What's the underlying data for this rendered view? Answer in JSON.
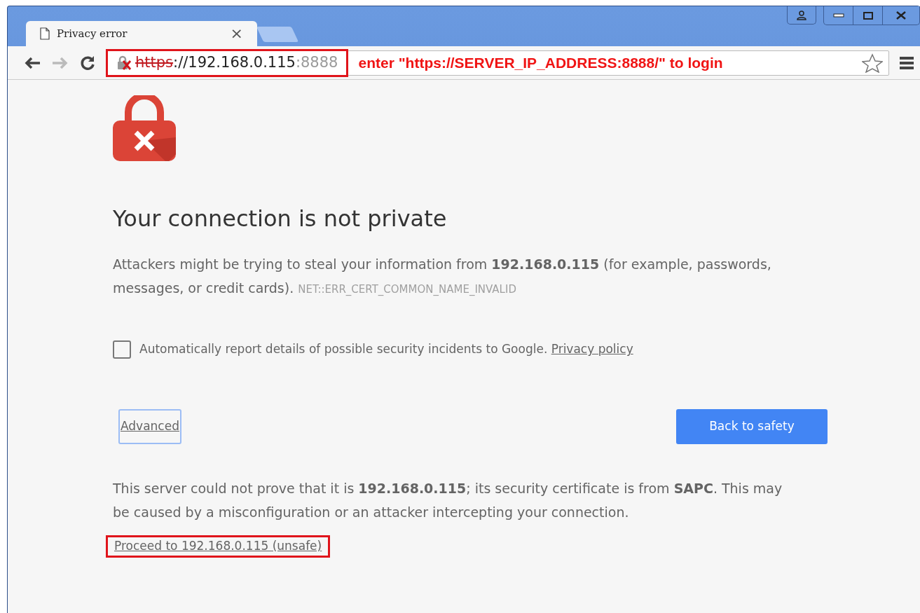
{
  "tab": {
    "title": "Privacy error",
    "close": "×"
  },
  "address_bar": {
    "scheme": "https",
    "host": "://192.168.0.115",
    "port": ":8888",
    "insecure": true
  },
  "annotation": "enter \"https://SERVER_IP_ADDRESS:8888/\" to login",
  "heading": "Your connection is not private",
  "message": "Attackers might be trying to steal your information from **192.168.0.115** (for example, passwords, messages, or credit cards).",
  "error_code": "NET::ERR_CERT_COMMON_NAME_INVALID",
  "report_option": {
    "label": "Automatically report details of possible security incidents to Google.",
    "link": "Privacy policy",
    "checked": false
  },
  "advanced_link": {
    "label": "Advanced",
    "focused": true
  },
  "back_button": "Back to safety",
  "details": "This server could not prove that it is **192.168.0.115**; its security certificate is from **SAPC**. This may be caused by a misconfiguration or an attacker intercepting your connection.",
  "proceed_link": {
    "label": "Proceed to 192.168.0.115 (unsafe)",
    "highlighted": true
  }
}
